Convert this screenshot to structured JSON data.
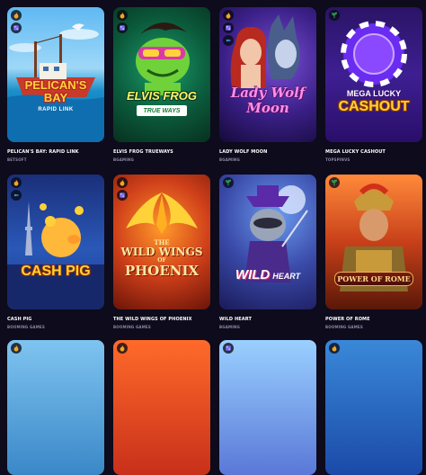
{
  "games": [
    {
      "title": "PELICAN'S BAY: RAPID LINK",
      "provider": "BETSOFT",
      "logo_line1": "PELICAN'S",
      "logo_line2": "BAY",
      "logo_sub": "RAPID LINK",
      "badges": [
        "fire-icon",
        "dice-icon"
      ]
    },
    {
      "title": "ELVIS FROG TRUEWAYS",
      "provider": "BGAMING",
      "logo_line1": "ELVIS FROG",
      "logo_sub": "TRUE WAYS",
      "badges": [
        "fire-icon",
        "dice-icon"
      ]
    },
    {
      "title": "LADY WOLF MOON",
      "provider": "BGAMING",
      "logo_line1": "Lady Wolf",
      "logo_line2": "Moon",
      "badges": [
        "fire-icon",
        "dice-icon",
        "bonus-icon"
      ]
    },
    {
      "title": "MEGA LUCKY CASHOUT",
      "provider": "TOPSPINVS",
      "logo_line1": "MEGA LUCKY",
      "logo_line2": "CASHOUT",
      "badges": [
        "sprout-icon"
      ]
    },
    {
      "title": "CASH PIG",
      "provider": "BOOMING GAMES",
      "logo_line1": "CASH PIG",
      "badges": [
        "fire-icon",
        "bonus-icon"
      ]
    },
    {
      "title": "THE WILD WINGS OF PHOENIX",
      "provider": "BOOMING GAMES",
      "logo_line1": "THE",
      "logo_line2": "WILD WINGS",
      "logo_line3": "OF",
      "logo_line4": "PHOENIX",
      "badges": [
        "fire-icon",
        "dice-icon"
      ]
    },
    {
      "title": "WILD HEART",
      "provider": "BGAMING",
      "logo_line1": "WILD",
      "logo_line2": "HEART",
      "badges": [
        "sprout-icon"
      ]
    },
    {
      "title": "POWER OF ROME",
      "provider": "BOOMING GAMES",
      "logo_line1": "POWER OF ROME",
      "badges": [
        "sprout-icon"
      ]
    }
  ],
  "colors": {
    "background": "#0d0b1c",
    "provider_text": "#8c8aa3",
    "badge_fire": "#f5a524",
    "badge_dice": "#7b6cf6",
    "badge_bonus": "#3fb4f0",
    "badge_sprout": "#38c172"
  }
}
